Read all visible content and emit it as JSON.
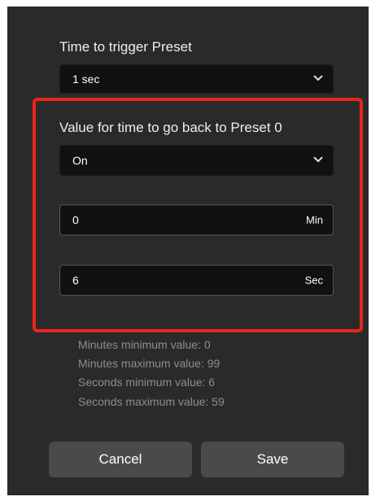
{
  "dialog": {
    "trigger": {
      "label": "Time to trigger Preset",
      "selected": "1 sec"
    },
    "go_back": {
      "label": "Value for time to go back to Preset 0",
      "selected": "On",
      "minutes_value": "0",
      "minutes_unit": "Min",
      "seconds_value": "6",
      "seconds_unit": "Sec"
    },
    "limits": [
      "Minutes minimum value: 0",
      "Minutes maximum value: 99",
      "Seconds minimum value: 6",
      "Seconds maximum value: 59"
    ],
    "buttons": {
      "cancel": "Cancel",
      "save": "Save"
    }
  },
  "icons": {
    "dropdown": "chevron-down-icon"
  },
  "colors": {
    "dialog_bg": "#2a2a2a",
    "field_bg": "#111111",
    "highlight": "#e8251c",
    "button_bg": "#4a4a4a",
    "info_text": "#8e8e8e"
  }
}
